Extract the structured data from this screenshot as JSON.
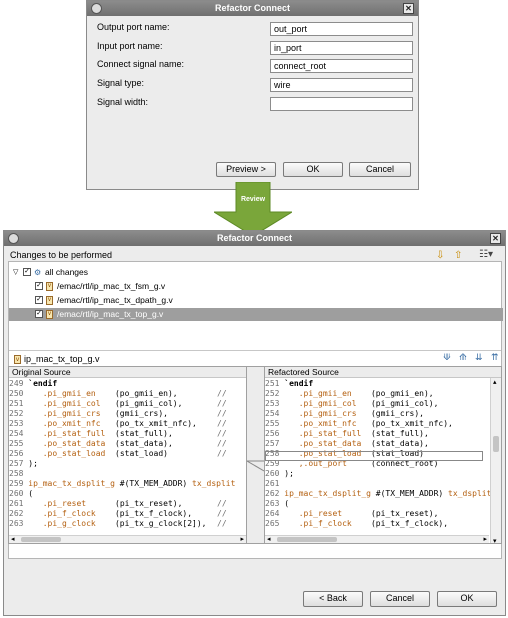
{
  "dialog1": {
    "title": "Refactor Connect",
    "fields": [
      {
        "label": "Output port name:",
        "value": "out_port"
      },
      {
        "label": "Input port name:",
        "value": "in_port"
      },
      {
        "label": "Connect signal name:",
        "value": "connect_root"
      },
      {
        "label": "Signal type:",
        "value": "wire"
      },
      {
        "label": "Signal width:",
        "value": ""
      }
    ],
    "buttons": {
      "preview": "Preview >",
      "ok": "OK",
      "cancel": "Cancel"
    }
  },
  "arrow_label": "Review",
  "dialog2": {
    "title": "Refactor Connect",
    "changes_header": "Changes to be performed",
    "tree": {
      "root": "all changes",
      "items": [
        "/emac/rtl/ip_mac_tx_fsm_g.v",
        "/emac/rtl/ip_mac_tx_dpath_g.v",
        "/emac/rtl/ip_mac_tx_top_g.v"
      ]
    },
    "compare_file": "ip_mac_tx_top_g.v",
    "original_header": "Original Source",
    "refactored_header": "Refactored Source",
    "original_lines": [
      {
        "n": "249",
        "code": "`endif",
        "type": "kw"
      },
      {
        "n": "250",
        "port": ".pi_gmii_en",
        "arg": "(po_gmii_en),",
        "cmt": "//"
      },
      {
        "n": "251",
        "port": ".pi_gmii_col",
        "arg": "(pi_gmii_col),",
        "cmt": "//"
      },
      {
        "n": "252",
        "port": ".pi_gmii_crs",
        "arg": "(gmii_crs),",
        "cmt": "//"
      },
      {
        "n": "253",
        "port": ".po_xmit_nfc",
        "arg": "(po_tx_xmit_nfc),",
        "cmt": "//"
      },
      {
        "n": "254",
        "port": ".pi_stat_full",
        "arg": "(stat_full),",
        "cmt": "//"
      },
      {
        "n": "255",
        "port": ".po_stat_data",
        "arg": "(stat_data),",
        "cmt": "//"
      },
      {
        "n": "256",
        "port": ".po_stat_load",
        "arg": "(stat_load)",
        "cmt": "//"
      },
      {
        "n": "257",
        "code": ");",
        "type": "plain"
      },
      {
        "n": "258",
        "code": "",
        "type": "plain"
      },
      {
        "n": "259",
        "inst": "ip_mac_tx_dsplit_g",
        "mid": " #(TX_MEM_ADDR) ",
        "name": "tx_dsplit"
      },
      {
        "n": "260",
        "code": "(",
        "type": "plain"
      },
      {
        "n": "261",
        "port": ".pi_reset",
        "arg": "(pi_tx_reset),",
        "cmt": "//"
      },
      {
        "n": "262",
        "port": ".pi_f_clock",
        "arg": "(pi_tx_f_clock),",
        "cmt": "//"
      },
      {
        "n": "263",
        "port": ".pi_g_clock",
        "arg": "(pi_tx_g_clock[2]),",
        "cmt": "//"
      }
    ],
    "refactored_lines": [
      {
        "n": "251",
        "code": "`endif",
        "type": "kw"
      },
      {
        "n": "252",
        "port": ".pi_gmii_en",
        "arg": "(po_gmii_en),"
      },
      {
        "n": "253",
        "port": ".pi_gmii_col",
        "arg": "(pi_gmii_col),"
      },
      {
        "n": "254",
        "port": ".pi_gmii_crs",
        "arg": "(gmii_crs),"
      },
      {
        "n": "255",
        "port": ".po_xmit_nfc",
        "arg": "(po_tx_xmit_nfc),"
      },
      {
        "n": "256",
        "port": ".pi_stat_full",
        "arg": "(stat_full),"
      },
      {
        "n": "257",
        "port": ".po_stat_data",
        "arg": "(stat_data),"
      },
      {
        "n": "258",
        "port": ".po_stat_load",
        "arg": "(stat_load)"
      },
      {
        "n": "259",
        "port": ",.out_port",
        "arg": "(connect_root)"
      },
      {
        "n": "260",
        "code": ");",
        "type": "plain"
      },
      {
        "n": "261",
        "code": "",
        "type": "plain"
      },
      {
        "n": "262",
        "inst": "ip_mac_tx_dsplit_g",
        "mid": " #(TX_MEM_ADDR) ",
        "name": "tx_dsplit"
      },
      {
        "n": "263",
        "code": "(",
        "type": "plain"
      },
      {
        "n": "264",
        "port": ".pi_reset",
        "arg": "(pi_tx_reset),"
      },
      {
        "n": "265",
        "port": ".pi_f_clock",
        "arg": "(pi_tx_f_clock),"
      }
    ],
    "buttons": {
      "back": "< Back",
      "cancel": "Cancel",
      "ok": "OK"
    }
  },
  "colors": {
    "port": "#b46010",
    "arrow": "#7aa63a",
    "selection": "#9e9e9e"
  }
}
